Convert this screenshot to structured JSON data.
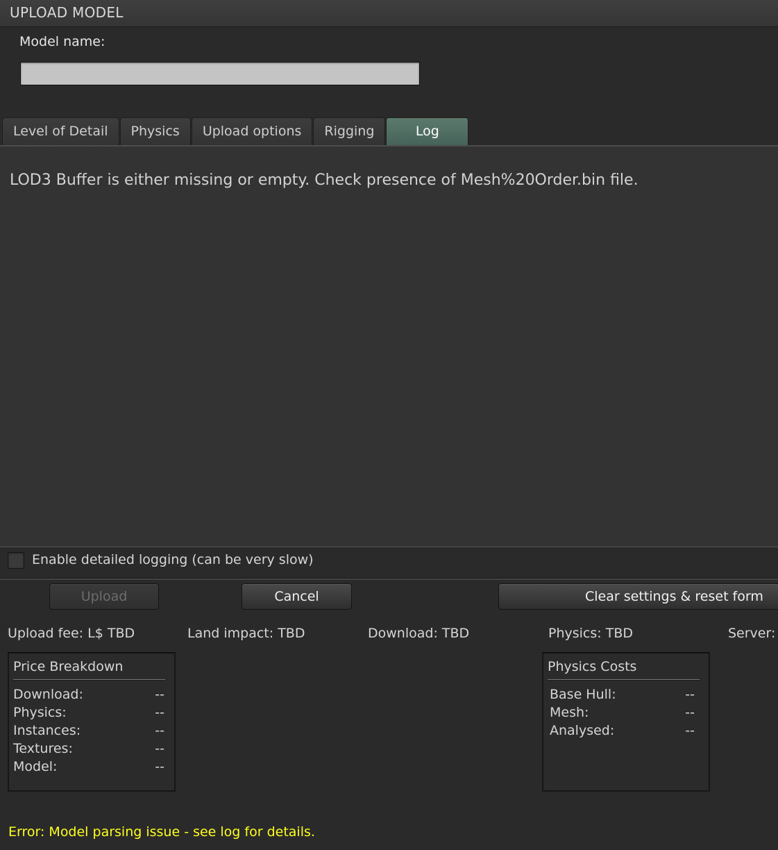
{
  "window": {
    "title": "UPLOAD MODEL"
  },
  "model_name": {
    "label": "Model name:",
    "value": "",
    "placeholder": ""
  },
  "tabs": [
    {
      "label": "Level of Detail",
      "active": false
    },
    {
      "label": "Physics",
      "active": false
    },
    {
      "label": "Upload options",
      "active": false
    },
    {
      "label": "Rigging",
      "active": false
    },
    {
      "label": "Log",
      "active": true
    }
  ],
  "log": {
    "message": "LOD3 Buffer is either missing or empty. Check presence of Mesh%20Order.bin file."
  },
  "detailed_logging": {
    "label": "Enable detailed logging (can be very slow)",
    "checked": false
  },
  "buttons": {
    "upload": "Upload",
    "cancel": "Cancel",
    "clear": "Clear settings & reset form"
  },
  "stats": {
    "upload_fee": "Upload fee: L$ TBD",
    "land_impact": "Land impact: TBD",
    "download": "Download: TBD",
    "physics": "Physics: TBD",
    "server": "Server:"
  },
  "price_breakdown": {
    "title": "Price Breakdown",
    "rows": [
      {
        "label": "Download:",
        "value": "--"
      },
      {
        "label": "Physics:",
        "value": "--"
      },
      {
        "label": "Instances:",
        "value": "--"
      },
      {
        "label": "Textures:",
        "value": "--"
      },
      {
        "label": "Model:",
        "value": "--"
      }
    ]
  },
  "physics_costs": {
    "title": "Physics Costs",
    "rows": [
      {
        "label": "Base Hull:",
        "value": "--"
      },
      {
        "label": "Mesh:",
        "value": "--"
      },
      {
        "label": "Analysed:",
        "value": "--"
      }
    ]
  },
  "status": {
    "error": "Error: Model parsing issue - see log for details.",
    "color": "#ffff1f"
  }
}
